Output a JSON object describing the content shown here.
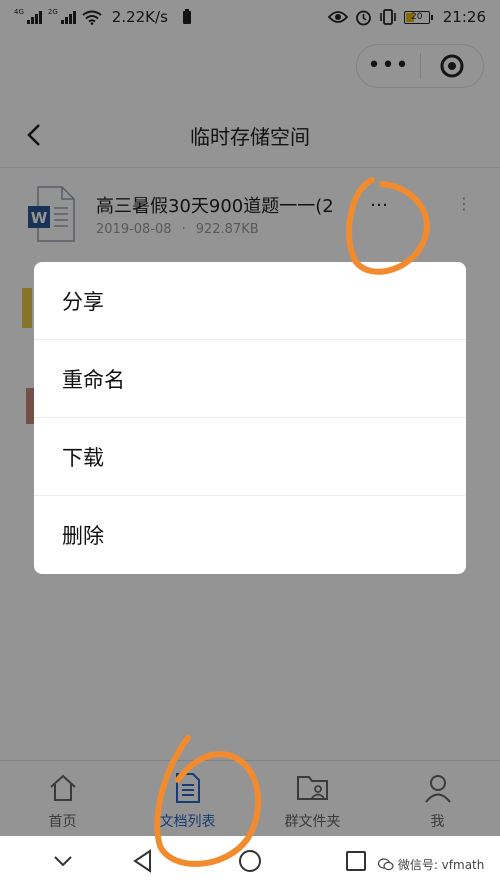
{
  "status_bar": {
    "net_1": "4G",
    "net_2": "2G",
    "speed": "2.22K/s",
    "battery": "20",
    "time": "21:26"
  },
  "capsule": {
    "more_icon": "more-dots-icon",
    "close_icon": "target-circle-icon"
  },
  "header": {
    "title": "临时存储空间",
    "back_icon": "chevron-left-icon"
  },
  "files": [
    {
      "name": "高三暑假30天900道题一一(2",
      "date": "2019-08-08",
      "sep": "·",
      "size": "922.87KB",
      "icon": "word-doc-icon"
    }
  ],
  "file_row_more": "…",
  "action_sheet": {
    "items": [
      "分享",
      "重命名",
      "下载",
      "删除"
    ]
  },
  "tab_bar": {
    "items": [
      {
        "label": "首页",
        "icon": "home-icon"
      },
      {
        "label": "文档列表",
        "icon": "document-list-icon"
      },
      {
        "label": "群文件夹",
        "icon": "group-folder-icon"
      },
      {
        "label": "我",
        "icon": "user-icon"
      }
    ],
    "active_index": 1
  },
  "system_nav": {
    "watermark": "微信号: vfmath"
  },
  "colors": {
    "accent": "#2b67c6",
    "annotation": "#f28a2e",
    "word": "#2b5797"
  }
}
